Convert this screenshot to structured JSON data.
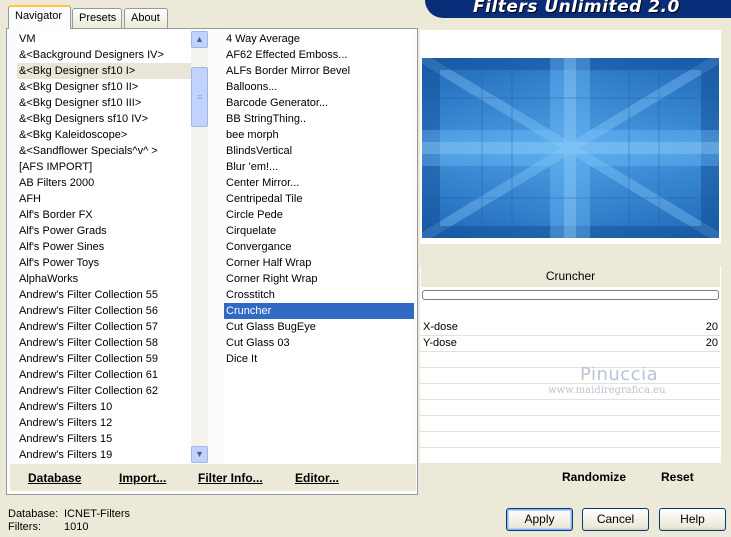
{
  "banner": {
    "title": "Filters Unlimited 2.0"
  },
  "tabs": [
    {
      "label": "Navigator",
      "active": true
    },
    {
      "label": "Presets",
      "active": false
    },
    {
      "label": "About",
      "active": false
    }
  ],
  "categories": {
    "items": [
      "VM",
      "&<Background Designers IV>",
      "&<Bkg Designer sf10 I>",
      "&<Bkg Designer sf10 II>",
      "&<Bkg Designer sf10 III>",
      "&<Bkg Designers sf10 IV>",
      "&<Bkg Kaleidoscope>",
      "&<Sandflower Specials^v^ >",
      "[AFS IMPORT]",
      "AB Filters 2000",
      "AFH",
      "Alf's Border FX",
      "Alf's Power Grads",
      "Alf's Power Sines",
      "Alf's Power Toys",
      "AlphaWorks",
      "Andrew's Filter Collection 55",
      "Andrew's Filter Collection 56",
      "Andrew's Filter Collection 57",
      "Andrew's Filter Collection 58",
      "Andrew's Filter Collection 59",
      "Andrew's Filter Collection 61",
      "Andrew's Filter Collection 62",
      "Andrew's Filters 10",
      "Andrew's Filters 12",
      "Andrew's Filters 15",
      "Andrew's Filters 19"
    ],
    "selected_index": 2
  },
  "filters": {
    "items": [
      "4 Way Average",
      "AF62 Effected Emboss...",
      "ALFs Border Mirror Bevel",
      "Balloons...",
      "Barcode Generator...",
      "BB StringThing..",
      "bee morph",
      "BlindsVertical",
      "Blur 'em!...",
      "Center Mirror...",
      "Centripedal Tile",
      "Circle Pede",
      "Cirquelate",
      "Convergance",
      "Corner Half Wrap",
      "Corner Right Wrap",
      "Crosstitch",
      "Cruncher",
      "Cut Glass  BugEye",
      "Cut Glass 03",
      "Dice It"
    ],
    "selected_index": 17
  },
  "bottom_links": {
    "database": "Database",
    "import": "Import...",
    "filter_info": "Filter Info...",
    "editor": "Editor..."
  },
  "filter_panel": {
    "title": "Cruncher",
    "params": [
      {
        "label": "X-dose",
        "value": "20"
      },
      {
        "label": "Y-dose",
        "value": "20"
      }
    ],
    "randomize": "Randomize",
    "reset": "Reset"
  },
  "watermark": {
    "name": "Pinuccia",
    "url": "www.maidiregrafica.eu"
  },
  "status": {
    "database_label": "Database:",
    "database_value": "ICNET-Filters",
    "filters_label": "Filters:",
    "filters_value": "1010"
  },
  "buttons": {
    "apply": "Apply",
    "cancel": "Cancel",
    "help": "Help"
  }
}
